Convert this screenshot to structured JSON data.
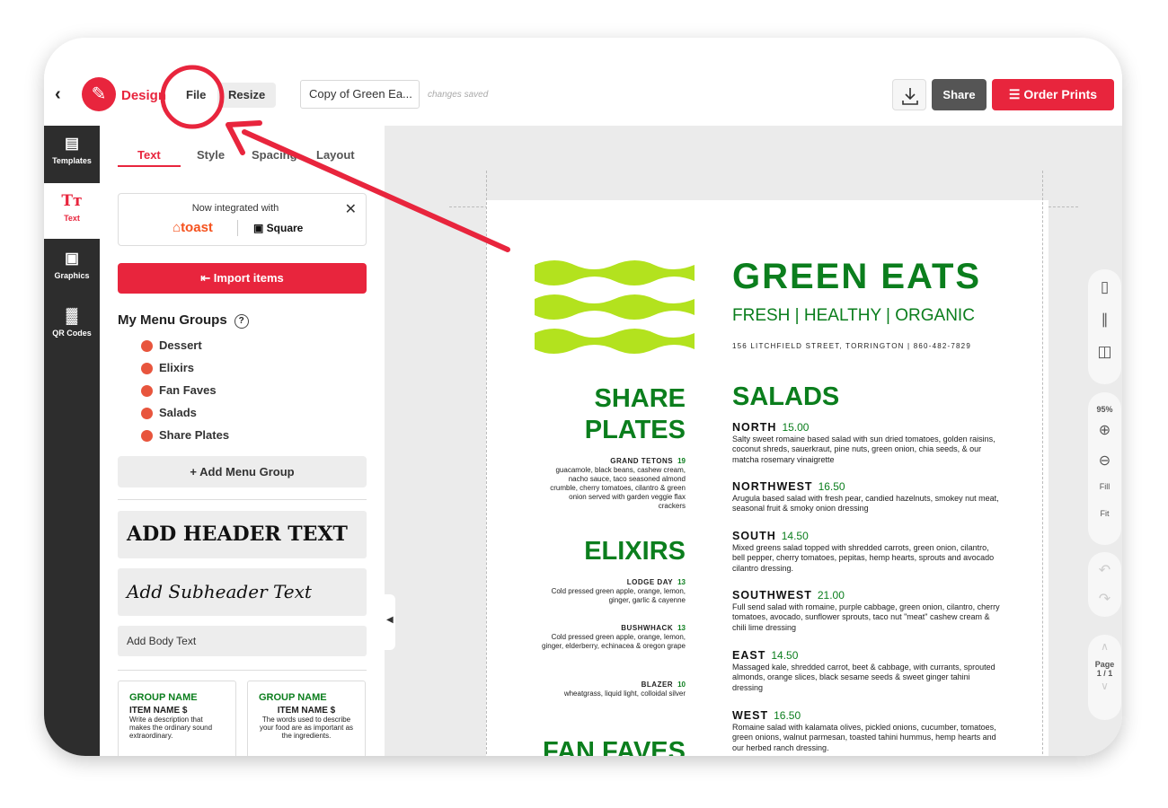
{
  "topbar": {
    "brand": "Design",
    "file_label": "File",
    "resize_label": "Resize",
    "doc_name": "Copy of Green Ea...",
    "saved_status": "changes saved",
    "share_label": "Share",
    "order_label": "Order Prints",
    "accent_color": "#e8253d"
  },
  "leftnav": [
    {
      "label": "Templates",
      "icon": "templates-icon"
    },
    {
      "label": "Text",
      "icon": "text-icon"
    },
    {
      "label": "Graphics",
      "icon": "graphics-icon"
    },
    {
      "label": "QR Codes",
      "icon": "qr-code-icon"
    }
  ],
  "panel": {
    "tabs": [
      "Text",
      "Style",
      "Spacing",
      "Layout"
    ],
    "integration_text": "Now integrated with",
    "toast_label": "toast",
    "square_label": "Square",
    "import_label": "Import items",
    "menu_groups_title": "My Menu Groups",
    "menu_groups": [
      "Dessert",
      "Elixirs",
      "Fan Faves",
      "Salads",
      "Share Plates"
    ],
    "add_group_label": "+ Add Menu Group",
    "header_text": "ADD HEADER TEXT",
    "subheader_text": "Add Subheader Text",
    "body_text": "Add Body Text",
    "cards": [
      {
        "group": "GROUP NAME",
        "item": "ITEM NAME $",
        "desc": "Write a description that makes the ordinary sound extraordinary."
      },
      {
        "group": "GROUP NAME",
        "item": "ITEM NAME $",
        "desc": "The words used to describe your food are as important as the ingredients."
      }
    ]
  },
  "menu": {
    "title": "GREEN EATS",
    "subtitle": "FRESH | HEALTHY | ORGANIC",
    "address": "156 LITCHFIELD STREET, TORRINGTON | 860-482-7829",
    "share_plates_1": "SHARE",
    "share_plates_2": "PLATES",
    "grand_tetons": {
      "name": "GRAND TETONS",
      "price": "19",
      "desc": "guacamole, black beans, cashew cream, nacho sauce, taco seasoned almond crumble, cherry tomatoes, cilantro & green onion served with garden veggie flax crackers"
    },
    "elixirs": "ELIXIRS",
    "lodge_day": {
      "name": "LODGE DAY",
      "price": "13",
      "desc": "Cold pressed green apple, orange, lemon, ginger, garlic & cayenne"
    },
    "bushwhack": {
      "name": "BUSHWHACK",
      "price": "13",
      "desc": "Cold pressed green apple, orange, lemon, ginger, elderberry, echinacea & oregon grape"
    },
    "blazer": {
      "name": "BLAZER",
      "price": "10",
      "desc": "wheatgrass, liquid light, colloidal silver"
    },
    "fan_faves": "FAN FAVES",
    "salads_title": "SALADS",
    "salads": [
      {
        "name": "NORTH",
        "price": "15.00",
        "desc": "Salty sweet romaine based salad with sun dried tomatoes, golden raisins, coconut shreds, sauerkraut, pine nuts, green onion, chia seeds, & our matcha rosemary vinaigrette"
      },
      {
        "name": "NORTHWEST",
        "price": "16.50",
        "desc": "Arugula based salad with fresh pear, candied hazelnuts, smokey nut meat, seasonal fruit & smoky onion dressing"
      },
      {
        "name": "SOUTH",
        "price": "14.50",
        "desc": "Mixed greens salad topped with shredded carrots, green onion, cilantro, bell pepper, cherry tomatoes, pepitas, hemp hearts, sprouts and avocado cilantro dressing."
      },
      {
        "name": "SOUTHWEST",
        "price": "21.00",
        "desc": "Full send salad with romaine, purple cabbage, green onion, cilantro, cherry tomatoes, avocado, sunflower sprouts, taco nut \"meat\" cashew cream & chili lime dressing"
      },
      {
        "name": "EAST",
        "price": "14.50",
        "desc": "Massaged kale, shredded carrot, beet & cabbage, with currants, sprouted almonds, orange slices, black sesame seeds & sweet ginger tahini dressing"
      },
      {
        "name": "WEST",
        "price": "16.50",
        "desc": "Romaine salad with kalamata olives, pickled onions, cucumber, tomatoes, green onions, walnut parmesan, toasted tahini hummus, hemp hearts and our herbed ranch dressing."
      }
    ],
    "green_color": "#0b7e1d",
    "wave_color": "#b3e21e"
  },
  "righttools": {
    "zoom": "95%",
    "fill_label": "Fill",
    "fit_label": "Fit",
    "page_label": "Page",
    "page_num": "1 / 1"
  }
}
